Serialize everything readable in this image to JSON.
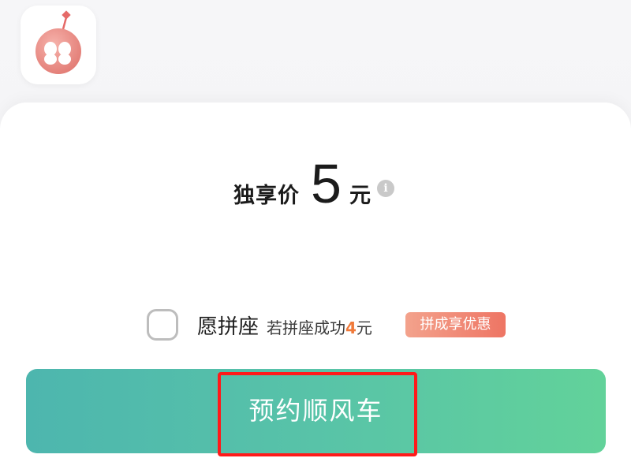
{
  "app": {
    "logo_icon": "pink-round-mascot-icon"
  },
  "price": {
    "prefix": "独享价",
    "value": "5",
    "unit": "元",
    "info_icon_glyph": "i"
  },
  "carpool": {
    "label": "愿拼座",
    "note_prefix": "若拼座成功",
    "note_amount": "4",
    "note_unit": "元",
    "badge": "拼成享优惠",
    "checked": false
  },
  "actions": {
    "book_label": "预约顺风车"
  },
  "colors": {
    "button_start": "#4db6ae",
    "button_end": "#62d29a",
    "highlight": "#ff1a1a",
    "amount": "#f07a3a",
    "badge": "#ee7564"
  }
}
